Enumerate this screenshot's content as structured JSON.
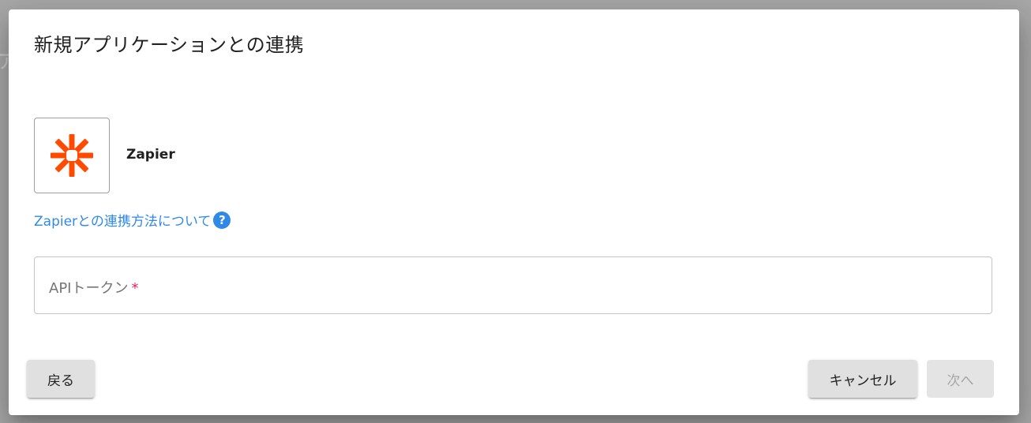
{
  "dialog": {
    "title": "新規アプリケーションとの連携"
  },
  "app": {
    "name": "Zapier",
    "logo_icon": "zapier-asterisk-icon",
    "logo_color": "#ff4a00"
  },
  "help": {
    "link_label": "Zapierとの連携方法について",
    "icon": "question-circle-icon",
    "icon_glyph": "?"
  },
  "token_field": {
    "label": "APIトークン",
    "required_mark": "*",
    "value": ""
  },
  "buttons": {
    "back_label": "戻る",
    "cancel_label": "キャンセル",
    "next_label": "次へ",
    "next_disabled": true
  },
  "colors": {
    "link": "#2f8ae6",
    "required": "#e0245e",
    "backdrop": "#a8a8a8"
  }
}
